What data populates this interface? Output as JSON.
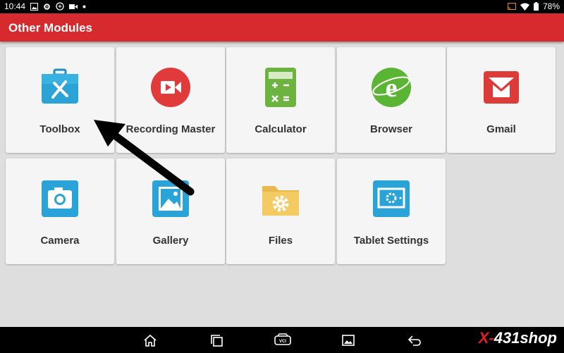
{
  "statusbar": {
    "time": "10:44",
    "battery": "78%"
  },
  "header": {
    "title": "Other Modules"
  },
  "modules": [
    {
      "label": "Toolbox",
      "icon": "toolbox-icon"
    },
    {
      "label": "Recording Master",
      "icon": "video-record-icon"
    },
    {
      "label": "Calculator",
      "icon": "calculator-icon"
    },
    {
      "label": "Browser",
      "icon": "browser-icon"
    },
    {
      "label": "Gmail",
      "icon": "gmail-icon"
    },
    {
      "label": "Camera",
      "icon": "camera-icon"
    },
    {
      "label": "Gallery",
      "icon": "gallery-icon"
    },
    {
      "label": "Files",
      "icon": "folder-settings-icon"
    },
    {
      "label": "Tablet Settings",
      "icon": "tablet-settings-icon"
    }
  ],
  "navbar": {
    "items": [
      "home-icon",
      "recent-apps-icon",
      "vci-icon",
      "screenshot-icon",
      "back-icon"
    ]
  },
  "watermark": {
    "x": "X-",
    "rest": "431shop"
  },
  "colors": {
    "header": "#d62a2e",
    "background": "#dedede",
    "tile": "#f5f5f5"
  }
}
